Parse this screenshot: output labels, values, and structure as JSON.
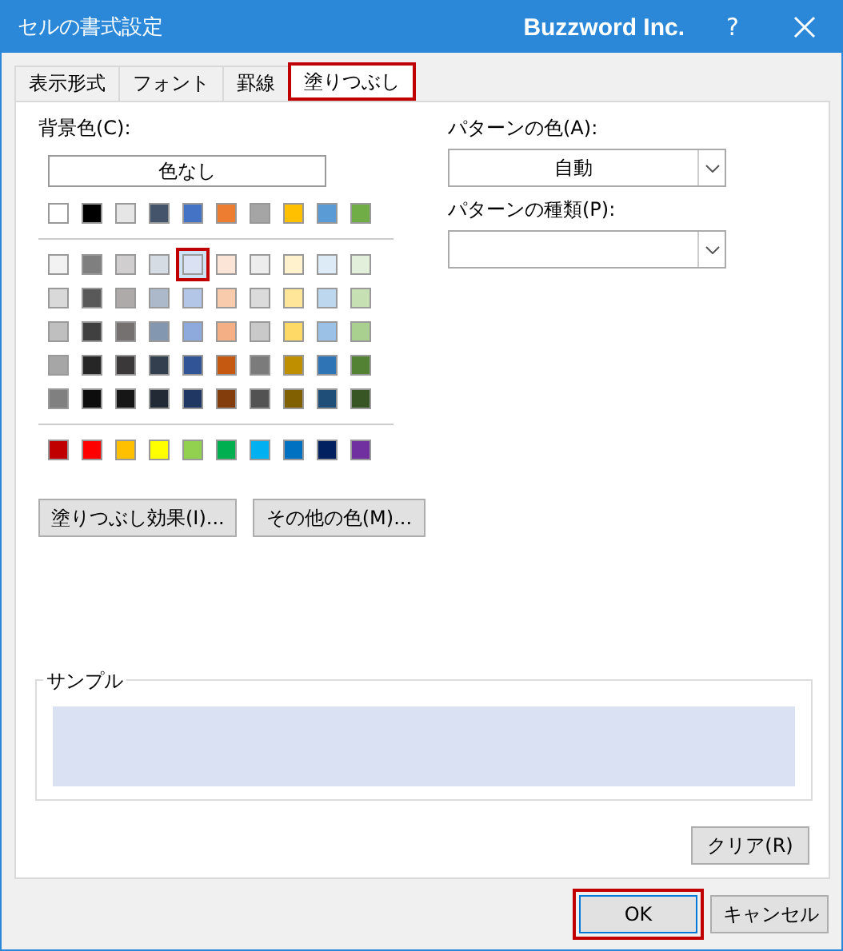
{
  "window": {
    "title": "セルの書式設定",
    "brand": "Buzzword Inc.",
    "help": "?"
  },
  "tabs": [
    {
      "label": "表示形式",
      "selected": false
    },
    {
      "label": "フォント",
      "selected": false
    },
    {
      "label": "罫線",
      "selected": false
    },
    {
      "label": "塗りつぶし",
      "selected": true
    }
  ],
  "background_color": {
    "label": "背景色(C):",
    "no_color_button": "色なし",
    "theme_colors": [
      {
        "color": "#ffffff",
        "selected": false
      },
      {
        "color": "#000000",
        "selected": false
      },
      {
        "color": "#e7e6e6",
        "selected": false
      },
      {
        "color": "#44546a",
        "selected": false
      },
      {
        "color": "#4472c4",
        "selected": false
      },
      {
        "color": "#ed7d31",
        "selected": false
      },
      {
        "color": "#a5a5a5",
        "selected": false
      },
      {
        "color": "#ffc000",
        "selected": false
      },
      {
        "color": "#5b9bd5",
        "selected": false
      },
      {
        "color": "#70ad47",
        "selected": false
      }
    ],
    "shades": [
      [
        {
          "color": "#f2f2f2",
          "selected": false
        },
        {
          "color": "#7f7f7f",
          "selected": false
        },
        {
          "color": "#d0cece",
          "selected": false
        },
        {
          "color": "#d6dce4",
          "selected": false
        },
        {
          "color": "#d9e1f2",
          "selected": true
        },
        {
          "color": "#fce4d6",
          "selected": false
        },
        {
          "color": "#ededed",
          "selected": false
        },
        {
          "color": "#fff2cc",
          "selected": false
        },
        {
          "color": "#ddebf7",
          "selected": false
        },
        {
          "color": "#e2efda",
          "selected": false
        }
      ],
      [
        {
          "color": "#d9d9d9",
          "selected": false
        },
        {
          "color": "#595959",
          "selected": false
        },
        {
          "color": "#aeaaaa",
          "selected": false
        },
        {
          "color": "#acb9ca",
          "selected": false
        },
        {
          "color": "#b4c6e7",
          "selected": false
        },
        {
          "color": "#f8cbad",
          "selected": false
        },
        {
          "color": "#dbdbdb",
          "selected": false
        },
        {
          "color": "#ffe699",
          "selected": false
        },
        {
          "color": "#bdd7ee",
          "selected": false
        },
        {
          "color": "#c6e0b4",
          "selected": false
        }
      ],
      [
        {
          "color": "#bfbfbf",
          "selected": false
        },
        {
          "color": "#404040",
          "selected": false
        },
        {
          "color": "#757171",
          "selected": false
        },
        {
          "color": "#8497b0",
          "selected": false
        },
        {
          "color": "#8ea9db",
          "selected": false
        },
        {
          "color": "#f4b084",
          "selected": false
        },
        {
          "color": "#c9c9c9",
          "selected": false
        },
        {
          "color": "#ffd966",
          "selected": false
        },
        {
          "color": "#9bc2e6",
          "selected": false
        },
        {
          "color": "#a9d08e",
          "selected": false
        }
      ],
      [
        {
          "color": "#a6a6a6",
          "selected": false
        },
        {
          "color": "#262626",
          "selected": false
        },
        {
          "color": "#3a3838",
          "selected": false
        },
        {
          "color": "#333f4f",
          "selected": false
        },
        {
          "color": "#305496",
          "selected": false
        },
        {
          "color": "#c65911",
          "selected": false
        },
        {
          "color": "#7b7b7b",
          "selected": false
        },
        {
          "color": "#bf8f00",
          "selected": false
        },
        {
          "color": "#2f75b5",
          "selected": false
        },
        {
          "color": "#548235",
          "selected": false
        }
      ],
      [
        {
          "color": "#808080",
          "selected": false
        },
        {
          "color": "#0d0d0d",
          "selected": false
        },
        {
          "color": "#161616",
          "selected": false
        },
        {
          "color": "#222b35",
          "selected": false
        },
        {
          "color": "#203764",
          "selected": false
        },
        {
          "color": "#833c0c",
          "selected": false
        },
        {
          "color": "#525252",
          "selected": false
        },
        {
          "color": "#806000",
          "selected": false
        },
        {
          "color": "#1f4e78",
          "selected": false
        },
        {
          "color": "#375623",
          "selected": false
        }
      ]
    ],
    "standard_colors": [
      {
        "color": "#c00000",
        "selected": false
      },
      {
        "color": "#ff0000",
        "selected": false
      },
      {
        "color": "#ffc000",
        "selected": false
      },
      {
        "color": "#ffff00",
        "selected": false
      },
      {
        "color": "#92d050",
        "selected": false
      },
      {
        "color": "#00b050",
        "selected": false
      },
      {
        "color": "#00b0f0",
        "selected": false
      },
      {
        "color": "#0070c0",
        "selected": false
      },
      {
        "color": "#002060",
        "selected": false
      },
      {
        "color": "#7030a0",
        "selected": false
      }
    ]
  },
  "effect_buttons": [
    "塗りつぶし効果(I)...",
    "その他の色(M)..."
  ],
  "pattern_color": {
    "label": "パターンの色(A):",
    "value": "自動"
  },
  "pattern_style": {
    "label": "パターンの種類(P):"
  },
  "sample": {
    "label": "サンプル"
  },
  "clear_button": "クリア(R)",
  "buttons": [
    {
      "label": "OK",
      "highlighted": true
    },
    {
      "label": "キャンセル",
      "highlighted": false
    }
  ]
}
